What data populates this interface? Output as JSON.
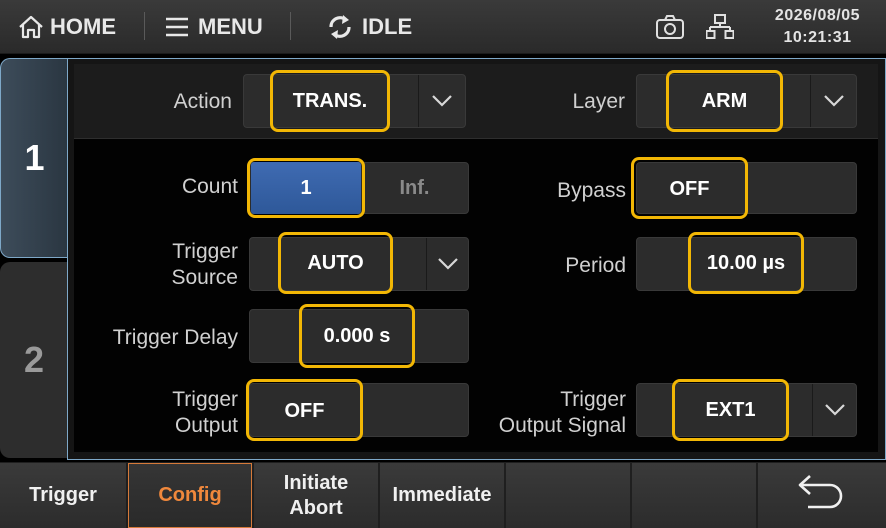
{
  "topbar": {
    "home_label": "HOME",
    "menu_label": "MENU",
    "status_label": "IDLE",
    "date": "2026/08/05",
    "time": "10:21:31"
  },
  "tabs": [
    {
      "label": "1",
      "active": true
    },
    {
      "label": "2",
      "active": false
    }
  ],
  "config": {
    "action": {
      "label": "Action",
      "value": "TRANS."
    },
    "layer": {
      "label": "Layer",
      "value": "ARM"
    },
    "count": {
      "label": "Count",
      "value": "1",
      "alt": "Inf."
    },
    "bypass": {
      "label": "Bypass",
      "value": "OFF"
    },
    "trigger_source": {
      "label_line1": "Trigger",
      "label_line2": "Source",
      "value": "AUTO"
    },
    "period": {
      "label": "Period",
      "value": "10.00 µs"
    },
    "trigger_delay": {
      "label": "Trigger Delay",
      "value": "0.000 s"
    },
    "trigger_output": {
      "label_line1": "Trigger",
      "label_line2": "Output",
      "value": "OFF"
    },
    "trigger_output_signal": {
      "label_line1": "Trigger",
      "label_line2": "Output Signal",
      "value": "EXT1"
    }
  },
  "softkeys": {
    "trigger": "Trigger",
    "config": "Config",
    "initiate": "Initiate",
    "abort": "Abort",
    "immediate": "Immediate"
  },
  "colors": {
    "highlight": "#f2b705",
    "accent_border": "#7ea8c8",
    "active_softkey": "#f0883c",
    "selected_button": "#2e5899"
  },
  "icons": [
    "home-icon",
    "menu-icon",
    "refresh-icon",
    "camera-icon",
    "network-icon",
    "chevron-down-icon",
    "back-icon"
  ]
}
